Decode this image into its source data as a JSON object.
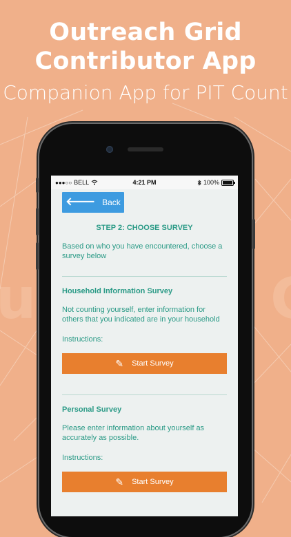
{
  "promo": {
    "title_line1": "Outreach Grid",
    "title_line2": "Contributor App",
    "subtitle": "Companion App for PIT Count"
  },
  "status_bar": {
    "carrier": "BELL",
    "signal_dots": "●●●○○",
    "time": "4:21 PM",
    "battery": "100%"
  },
  "screen": {
    "back_label": "Back",
    "step_title": "STEP 2: CHOOSE SURVEY",
    "intro": "Based on who you have encountered, choose a survey below",
    "surveys": [
      {
        "title": "Household Information Survey",
        "description": "Not counting yourself, enter information for others that you indicated are in your household",
        "instructions_label": "Instructions:",
        "button_label": "Start Survey"
      },
      {
        "title": "Personal Survey",
        "description": "Please enter information about yourself as accurately as possible.",
        "instructions_label": "Instructions:",
        "button_label": "Start Survey"
      }
    ]
  },
  "colors": {
    "background": "#f0b08a",
    "back_button": "#3d9be0",
    "accent_text": "#2a9a86",
    "start_button": "#e87f2e"
  },
  "icons": {
    "back": "arrow-left-icon",
    "start": "pencil-icon",
    "wifi": "wifi-icon",
    "bluetooth": "bluetooth-icon",
    "battery": "battery-icon"
  }
}
